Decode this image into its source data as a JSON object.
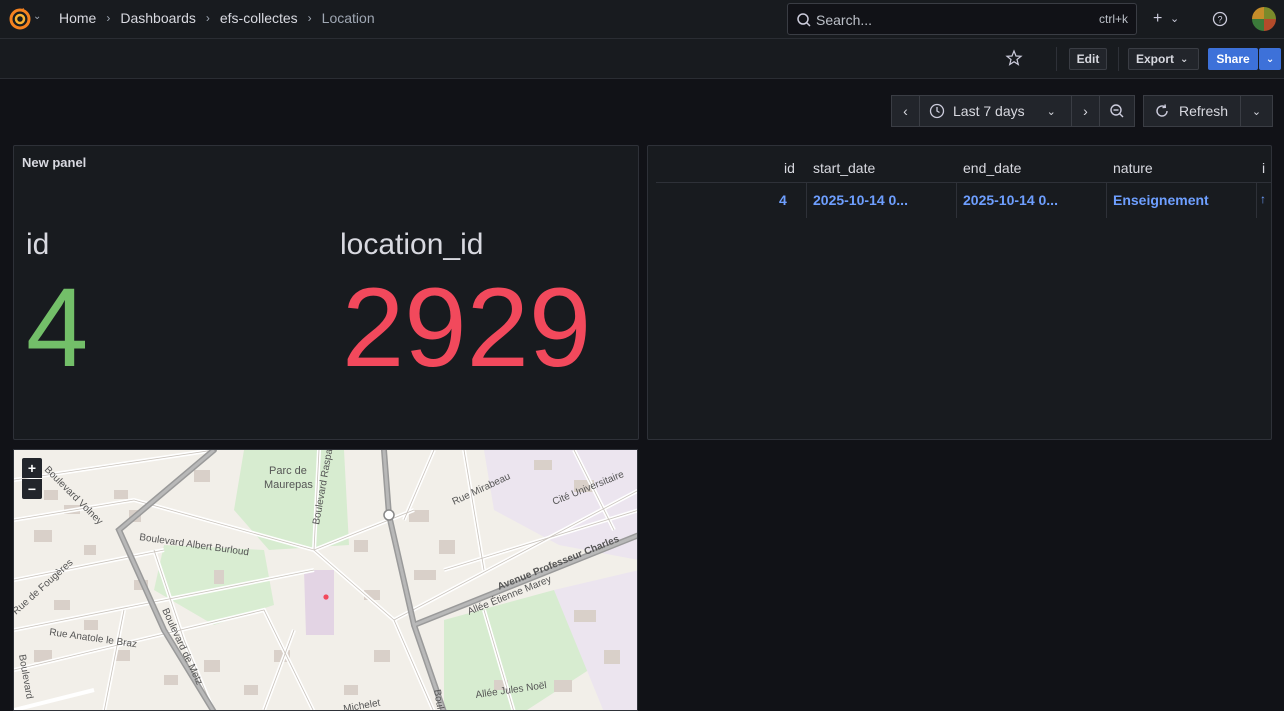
{
  "topbar": {
    "breadcrumbs": [
      {
        "label": "Home"
      },
      {
        "label": "Dashboards"
      },
      {
        "label": "efs-collectes"
      },
      {
        "label": "Location"
      }
    ],
    "search": {
      "placeholder": "Search...",
      "shortcut": "ctrl+k"
    },
    "icons": [
      "grafana-logo-icon",
      "plus-icon",
      "help-icon",
      "avatar"
    ]
  },
  "toolbar": {
    "edit_label": "Edit",
    "export_label": "Export",
    "share_label": "Share"
  },
  "time_picker": {
    "range_label": "Last 7 days",
    "refresh_label": "Refresh"
  },
  "stat_panel": {
    "title": "New panel",
    "fields": [
      {
        "label": "id",
        "value": "4",
        "color": "#73bf69"
      },
      {
        "label": "location_id",
        "value": "2929",
        "color": "#f2495c"
      }
    ]
  },
  "table_panel": {
    "headers": [
      "id",
      "start_date",
      "end_date",
      "nature",
      "i"
    ],
    "rows": [
      [
        "4",
        "2025-10-14 0...",
        "2025-10-14 0...",
        "Enseignement",
        "↑"
      ]
    ]
  },
  "map_panel": {
    "zoom_in": "+",
    "zoom_out": "−",
    "labels": {
      "parc": "Parc de",
      "parc2": "Maurepas",
      "volney": "Boulevard Volney",
      "burloud": "Boulevard Albert Burloud",
      "fougeres": "Rue de Fougères",
      "lebraz": "Rue Anatole le Braz",
      "metz": "Boulevard de Metz",
      "raspail": "Boulevard Raspail",
      "mirabeau": "Rue Mirabeau",
      "cite": "Cité Universitaire",
      "charles": "Avenue Professeur Charles",
      "marey": "Allée Étienne Marey",
      "noel": "Allée Jules Noël",
      "michelet": "Michelet",
      "boulevard": "Boulevard",
      "boul": "Boul"
    }
  }
}
